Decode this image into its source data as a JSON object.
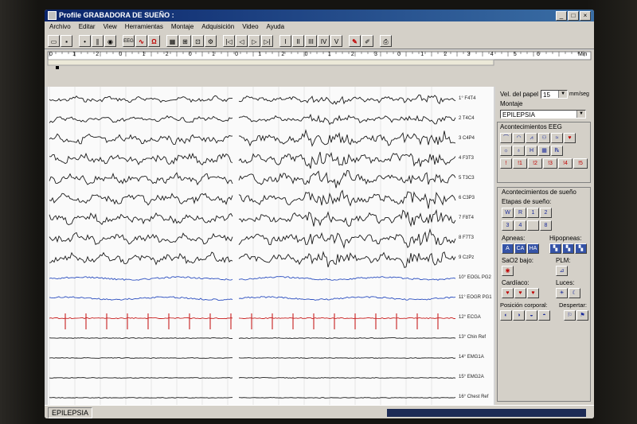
{
  "window": {
    "title": "Profile GRABADORA DE SUEÑO :",
    "min": "_",
    "max": "□",
    "close": "×"
  },
  "menu": [
    "Archivo",
    "Editar",
    "View",
    "Herramientas",
    "Montaje",
    "Adquisición",
    "Video",
    "Ayuda"
  ],
  "toolbar": {
    "eeg": "EEG",
    "omega": "Ω",
    "numerals": [
      "I",
      "II",
      "III",
      "IV",
      "V"
    ]
  },
  "ruler": {
    "labels": [
      "0",
      "1",
      "2",
      "0",
      "1",
      "2",
      "0",
      "1",
      "0",
      "1",
      "2",
      "0",
      "1",
      "2",
      "3",
      "0",
      "1",
      "2",
      "3",
      "4",
      "5",
      "6"
    ],
    "unit": "Min"
  },
  "channels": [
    "1° F4T4",
    "2 T4C4",
    "3 C4P4",
    "4 F3T3",
    "5 T3C3",
    "6 C3P3",
    "7 F8T4",
    "8 F7T3",
    "9 CzPz",
    "10° EOGL PG2",
    "11° EOGR PG1",
    "12° ECGA",
    "13° Chin Ref",
    "14° EMG1A",
    "15° EMG2A",
    "16° Chest Ref"
  ],
  "panel": {
    "paper_speed_label": "Vel. del papel",
    "paper_speed_value": "15",
    "paper_speed_unit": "mm/seg",
    "montage_label": "Montaje",
    "montage_value": "EPILEPSIA",
    "eeg_events_label": "Acontecimientos EEG",
    "eeg_events_row3": [
      "1",
      "2",
      "3",
      "4",
      "5"
    ],
    "sleep_events_label": "Acontecimientos de sueño",
    "sleep_stages_label": "Etapas de sueño:",
    "stages_row1": [
      "W",
      "R",
      "1",
      "2"
    ],
    "stages_row2": [
      "3",
      "4",
      "",
      "8"
    ],
    "apneas_label": "Apneas:",
    "apneas_buttons": [
      "A",
      "CA",
      "HA"
    ],
    "hypopneas_label": "Hipopneas:",
    "sao2_label": "SaO2 bajo:",
    "plm_label": "PLM:",
    "cardiac_label": "Cardíaco:",
    "lights_label": "Luces:",
    "position_label": "Posición corporal:",
    "arousal_label": "Despertar:"
  },
  "status": {
    "montage": "EPILEPSIA"
  },
  "colors": {
    "eeg_trace": "#1a1a1a",
    "eog_trace": "#2c4fc0",
    "ecg_trace": "#c81e1e",
    "titlebar": "#0a246a"
  }
}
